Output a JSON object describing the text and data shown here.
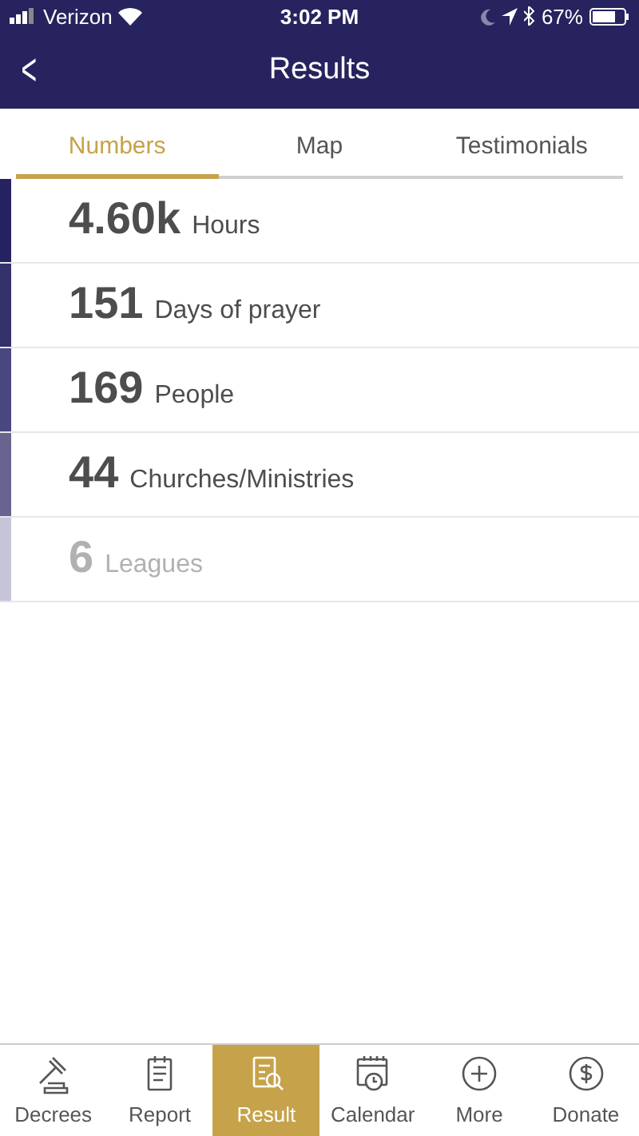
{
  "status_bar": {
    "carrier": "Verizon",
    "time": "3:02 PM",
    "battery": "67%"
  },
  "nav_bar": {
    "back": "<",
    "title": "Results"
  },
  "tabs": [
    {
      "label": "Numbers",
      "selected": true
    },
    {
      "label": "Map",
      "selected": false
    },
    {
      "label": "Testimonials",
      "selected": false
    }
  ],
  "stats": [
    {
      "value": "4.60k",
      "label": "Hours",
      "color": "#262262",
      "dimmed": false
    },
    {
      "value": "151",
      "label": "Days of prayer",
      "color": "#34316b",
      "dimmed": false
    },
    {
      "value": "169",
      "label": "People",
      "color": "#4a4780",
      "dimmed": false
    },
    {
      "value": "44",
      "label": "Churches/Ministries",
      "color": "#67648f",
      "dimmed": false
    },
    {
      "value": "6",
      "label": "Leagues",
      "color": "#c5c4d8",
      "dimmed": true
    }
  ],
  "tab_bar": [
    {
      "label": "Decrees",
      "selected": false
    },
    {
      "label": "Report",
      "selected": false
    },
    {
      "label": "Result",
      "selected": true
    },
    {
      "label": "Calendar",
      "selected": false
    },
    {
      "label": "More",
      "selected": false
    },
    {
      "label": "Donate",
      "selected": false
    }
  ]
}
